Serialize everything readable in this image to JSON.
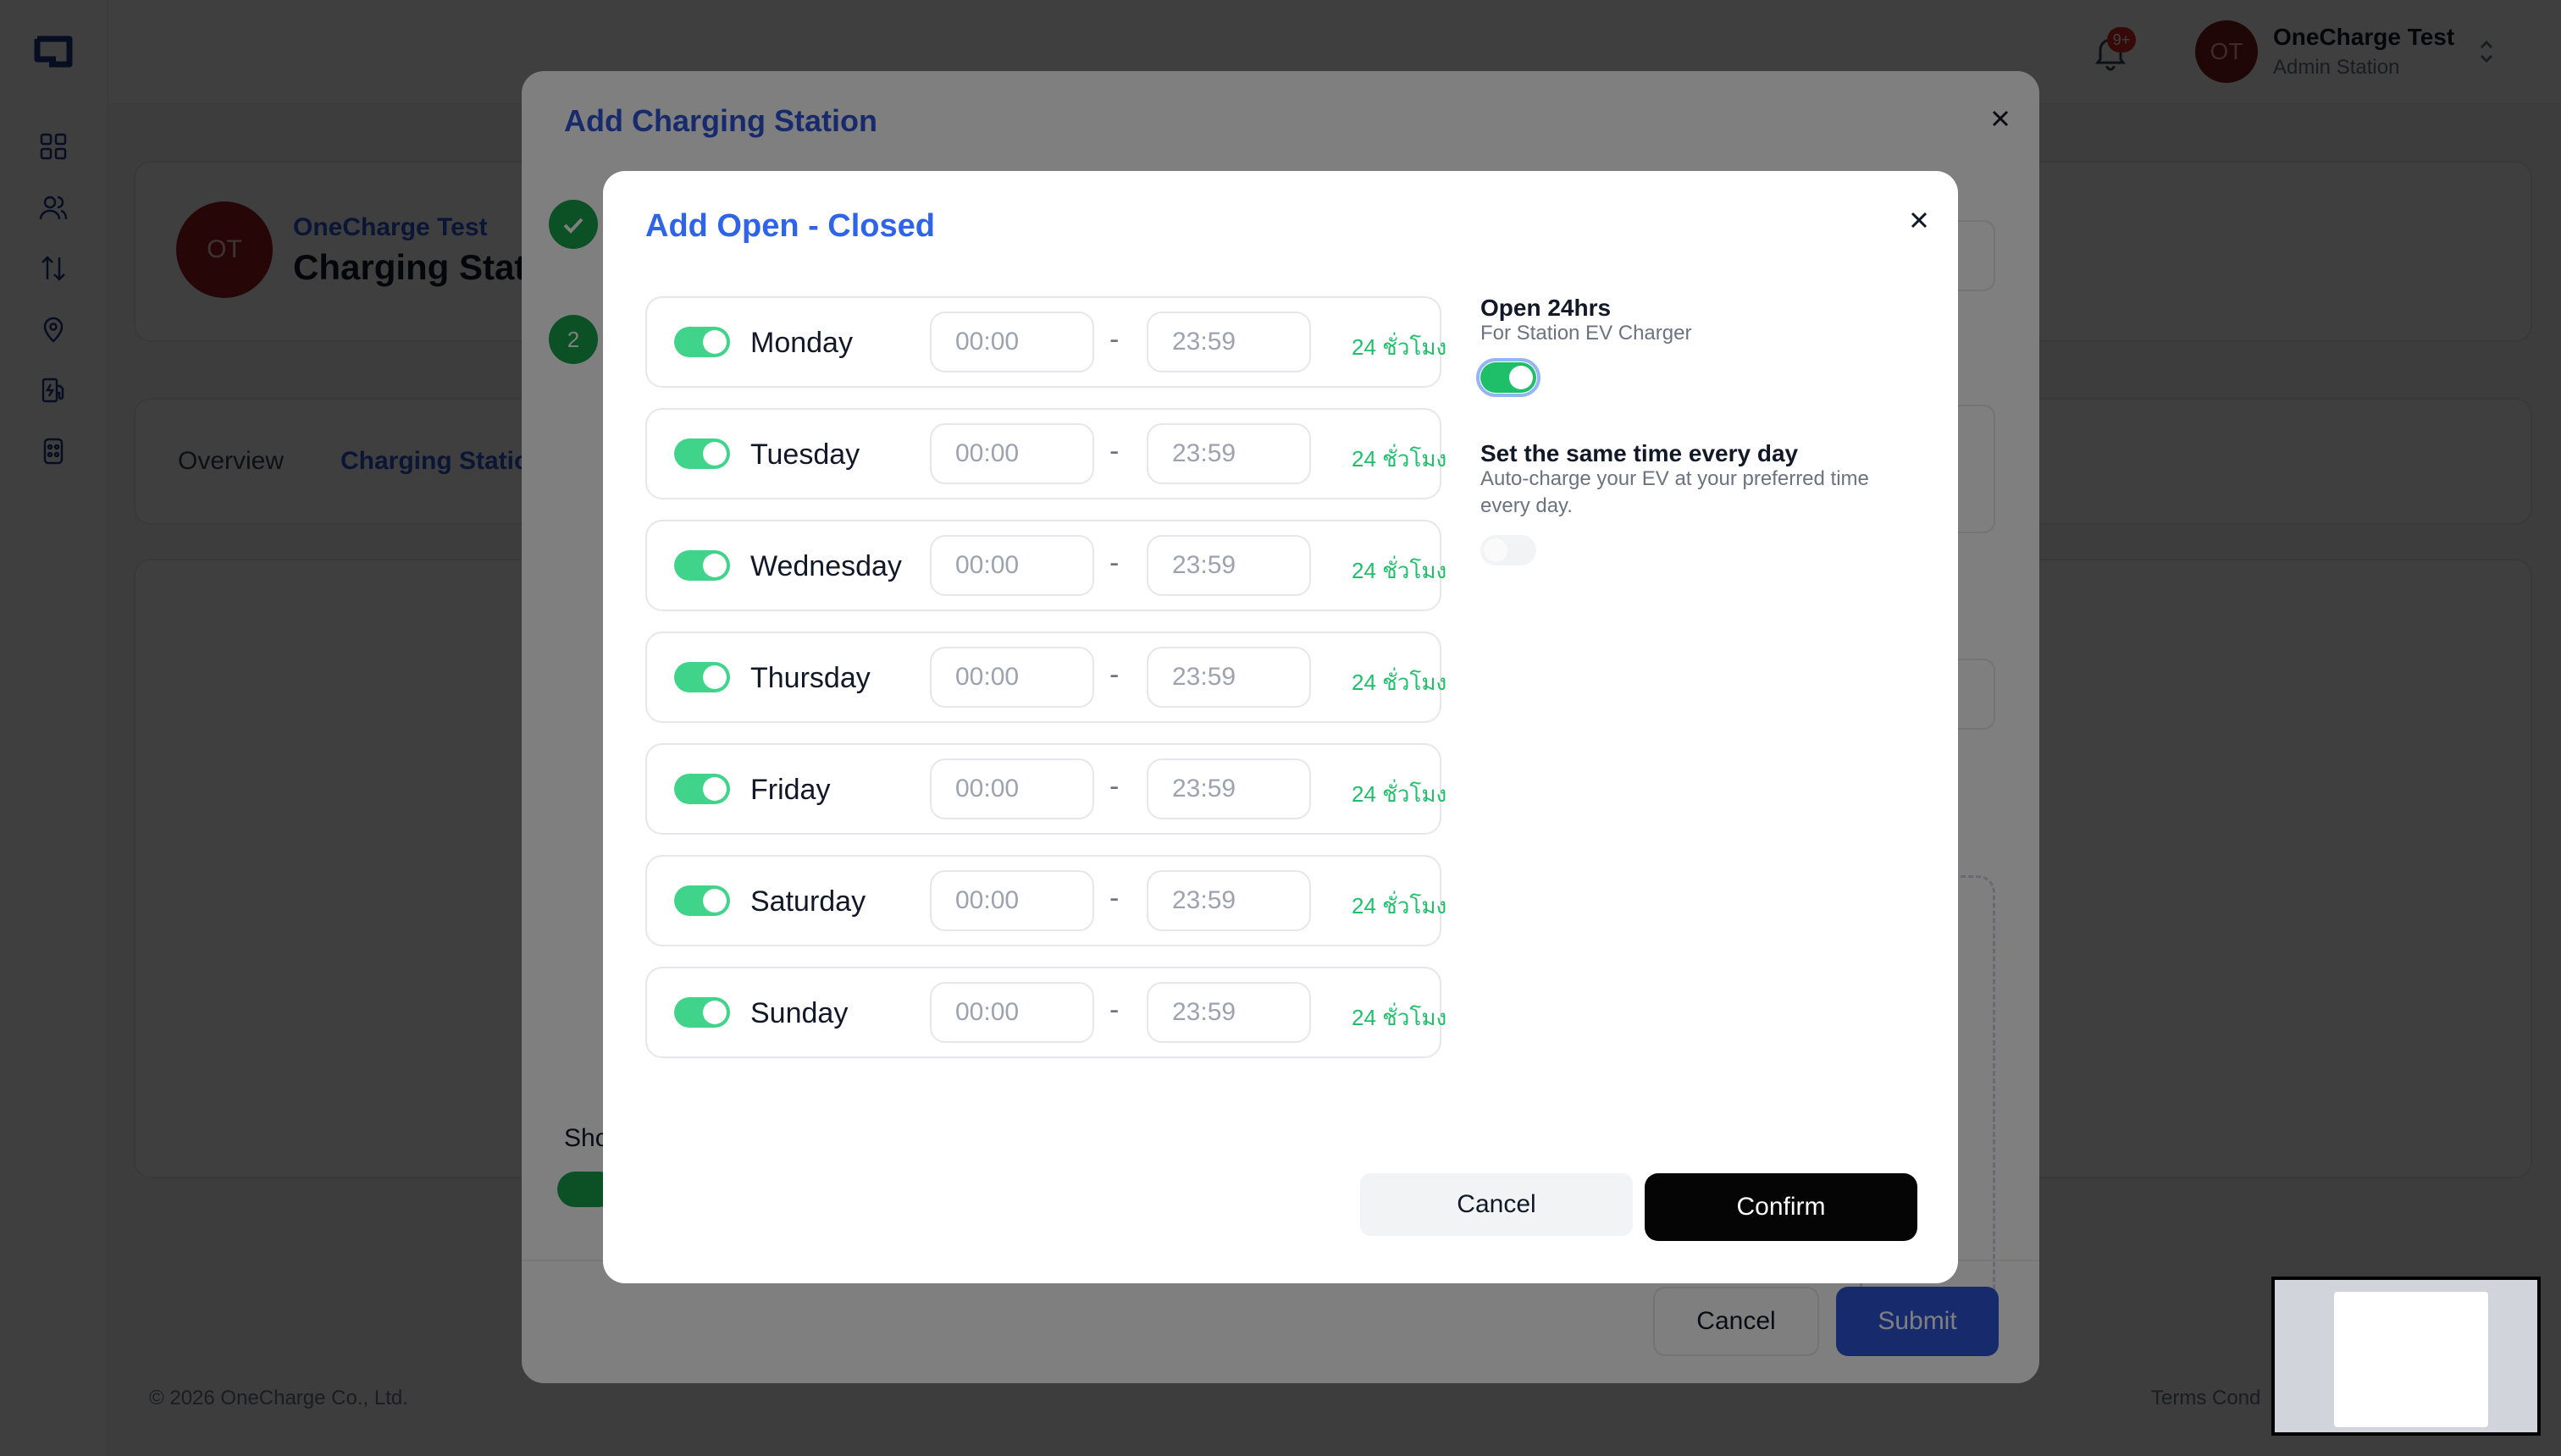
{
  "app": {
    "notification_count": "9+",
    "user": {
      "initials": "OT",
      "name": "OneCharge Test",
      "role": "Admin Station"
    }
  },
  "sidebar_icons": [
    "grid-icon",
    "users-icon",
    "transfer-icon",
    "location-icon",
    "charging-station-icon",
    "charger-icon"
  ],
  "page": {
    "station": {
      "initials": "OT",
      "owner": "OneCharge Test",
      "title": "Charging Stat"
    },
    "tabs": [
      {
        "label": "Overview"
      },
      {
        "label": "Charging Statio"
      }
    ],
    "footer": {
      "copyright": "© 2026 OneCharge Co., Ltd.",
      "terms": "Terms Cond"
    }
  },
  "outer_modal": {
    "title": "Add Charging Station",
    "step_two": "2",
    "show_label": "Sho",
    "cancel_label": "Cancel",
    "submit_label": "Submit"
  },
  "modal": {
    "title": "Add Open - Closed",
    "days": [
      {
        "name": "Monday",
        "open": "00:00",
        "close": "23:59",
        "hours": "24 ชั่วโมง",
        "enabled": true
      },
      {
        "name": "Tuesday",
        "open": "00:00",
        "close": "23:59",
        "hours": "24 ชั่วโมง",
        "enabled": true
      },
      {
        "name": "Wednesday",
        "open": "00:00",
        "close": "23:59",
        "hours": "24 ชั่วโมง",
        "enabled": true
      },
      {
        "name": "Thursday",
        "open": "00:00",
        "close": "23:59",
        "hours": "24 ชั่วโมง",
        "enabled": true
      },
      {
        "name": "Friday",
        "open": "00:00",
        "close": "23:59",
        "hours": "24 ชั่วโมง",
        "enabled": true
      },
      {
        "name": "Saturday",
        "open": "00:00",
        "close": "23:59",
        "hours": "24 ชั่วโมง",
        "enabled": true
      },
      {
        "name": "Sunday",
        "open": "00:00",
        "close": "23:59",
        "hours": "24 ชั่วโมง",
        "enabled": true
      }
    ],
    "separator": "-",
    "open24": {
      "title": "Open 24hrs",
      "desc": "For Station EV Charger",
      "enabled": true
    },
    "same_time": {
      "title": "Set the same time every day",
      "desc": "Auto-charge your EV at your preferred time every day.",
      "enabled": false
    },
    "cancel_label": "Cancel",
    "confirm_label": "Confirm"
  },
  "colors": {
    "brand_blue": "#2f56d8",
    "toggle_on": "#1fbf6a",
    "hours_text": "#1fbf6a",
    "confirm_bg": "#050505"
  }
}
